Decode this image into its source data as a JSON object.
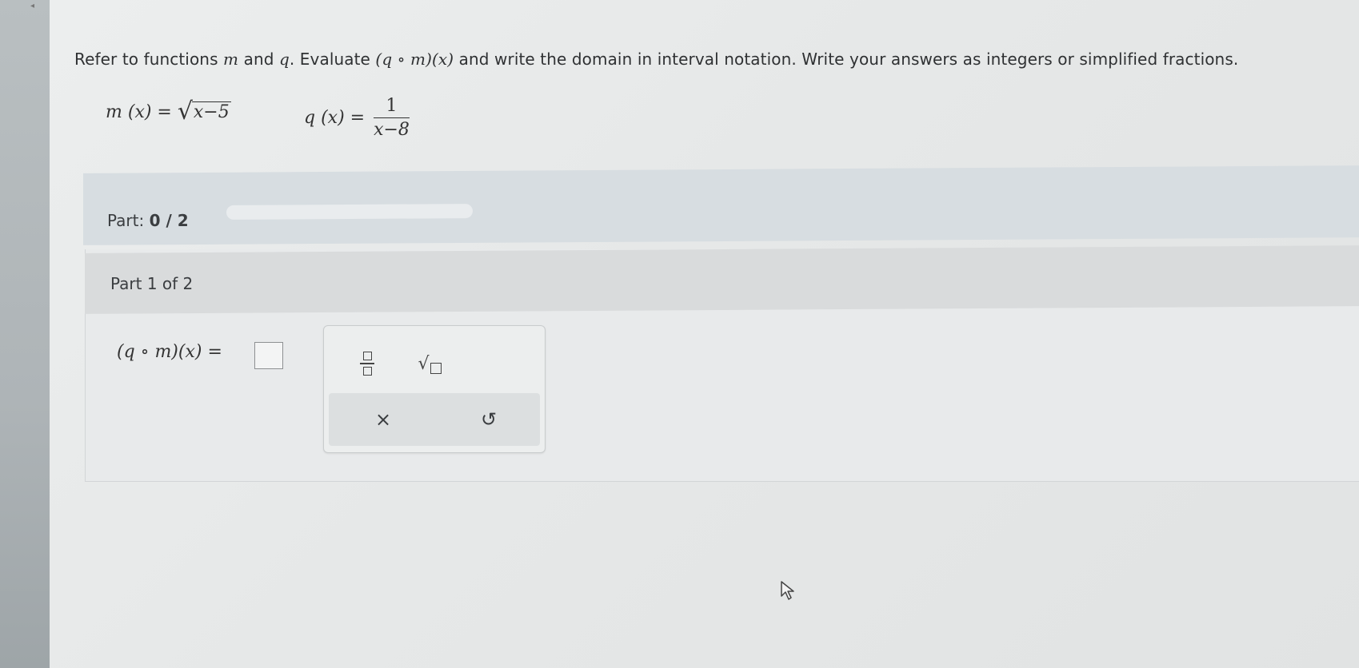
{
  "question": {
    "prompt_parts": [
      "Refer to functions ",
      "m",
      " and ",
      "q",
      ". Evaluate ",
      "(q ∘ m)(x)",
      " and write the domain in interval notation. Write your answers as integers or simplified fractions."
    ],
    "m_def": {
      "lhs": "m (x) = ",
      "radicand": "x−5"
    },
    "q_def": {
      "lhs": "q (x) = ",
      "numerator": "1",
      "denominator": "x−8"
    }
  },
  "progress": {
    "label": "Part: ",
    "value": "0 / 2",
    "fraction": 0
  },
  "part": {
    "title": "Part 1 of 2",
    "answer_label": "(q ∘ m)(x) = "
  },
  "keypad": {
    "fraction_icon": "fraction-icon",
    "sqrt_icon": "square-root-icon",
    "clear_symbol": "×",
    "undo_symbol": "↺"
  }
}
